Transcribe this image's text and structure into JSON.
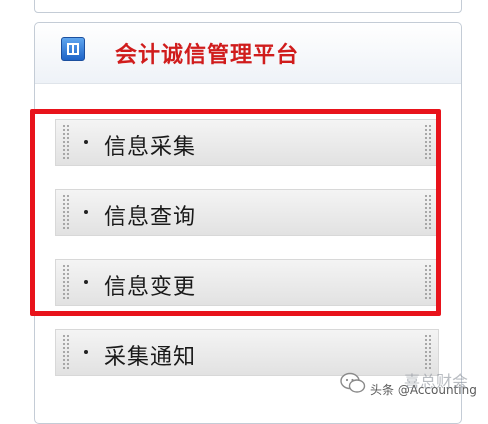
{
  "panel": {
    "title": "会计诚信管理平台",
    "icon": "panel-icon"
  },
  "menu": {
    "items": [
      {
        "label": "信息采集"
      },
      {
        "label": "信息查询"
      },
      {
        "label": "信息变更"
      },
      {
        "label": "采集通知"
      }
    ]
  },
  "highlight": {
    "color": "#e8131b"
  },
  "watermark": {
    "text": "头条 @Accounting",
    "brand": "喜总财会"
  },
  "colors": {
    "title": "#d01c1c",
    "icon": "#1e63c7"
  }
}
